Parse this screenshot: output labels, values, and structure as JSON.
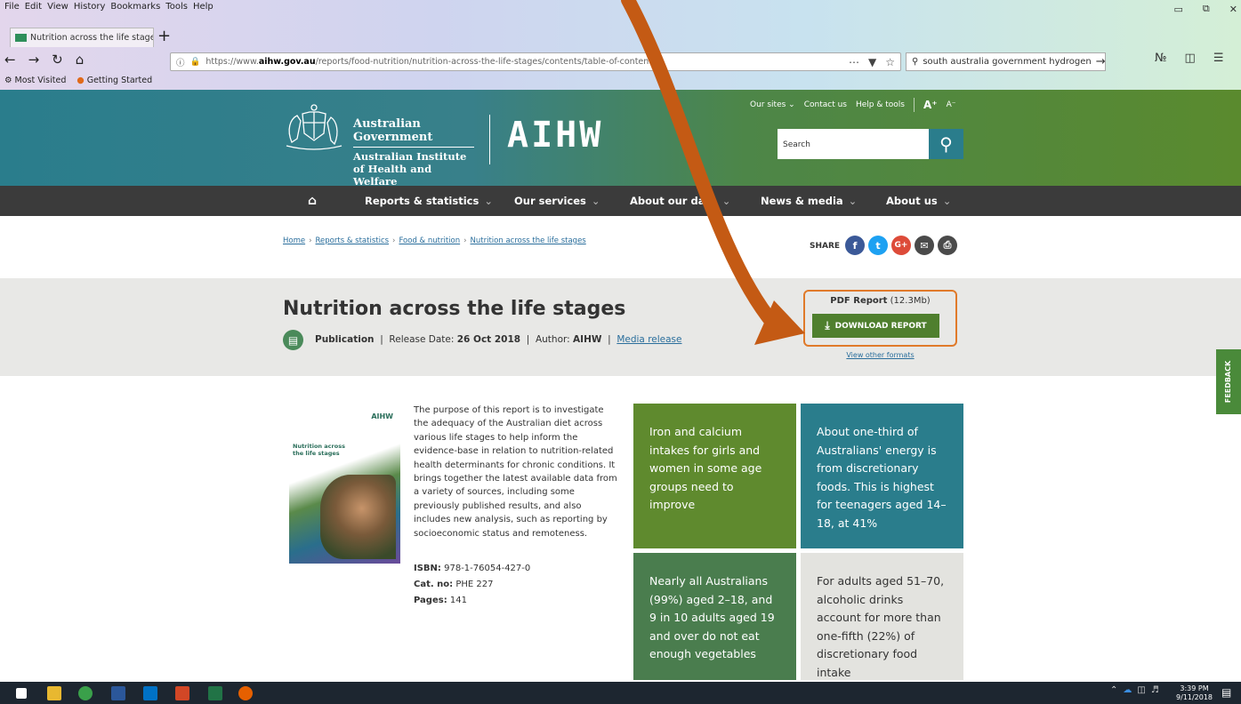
{
  "browser": {
    "menu": [
      "File",
      "Edit",
      "View",
      "History",
      "Bookmarks",
      "Tools",
      "Help"
    ],
    "tab_title": "Nutrition across the life stages",
    "url_prefix": "https://www.",
    "url_host": "aihw.gov.au",
    "url_path": "/reports/food-nutrition/nutrition-across-the-life-stages/contents/table-of-contents",
    "search_query": "south australia government hydrogen",
    "bookmarks": [
      "Most Visited",
      "Getting Started"
    ]
  },
  "site": {
    "gov_line1": "Australian Government",
    "gov_line2": "Australian Institute of Health and Welfare",
    "logo": "AIHW",
    "top_links": [
      "Our sites",
      "Contact us",
      "Help & tools"
    ],
    "font_larger": "A⁺",
    "font_smaller": "A⁻",
    "search_placeholder": "Search",
    "nav": [
      "Reports & statistics",
      "Our services",
      "About our data",
      "News & media",
      "About us"
    ],
    "breadcrumb": [
      "Home",
      "Reports & statistics",
      "Food & nutrition",
      "Nutrition across the life stages"
    ],
    "share_label": "SHARE"
  },
  "report": {
    "title": "Nutrition across the life stages",
    "type": "Publication",
    "release_label": "Release Date:",
    "release_date": "26 Oct 2018",
    "author_label": "Author:",
    "author": "AIHW",
    "media_release": "Media release",
    "pdf_label": "PDF Report",
    "pdf_size": "(12.3Mb)",
    "download_label": "DOWNLOAD REPORT",
    "other_formats": "View other formats",
    "feedback": "FEEDBACK",
    "cover_title": "Nutrition across the life stages",
    "cover_logo": "AIHW",
    "description": "The purpose of this report is to investigate the adequacy of the Australian diet across various life stages to help inform the evidence-base in relation to nutrition-related health determinants for chronic conditions. It brings together the latest available data from a variety of sources, including some previously published results, and also includes new analysis, such as reporting by socioeconomic status and remoteness.",
    "isbn_label": "ISBN:",
    "isbn": "978-1-76054-427-0",
    "catno_label": "Cat. no:",
    "catno": "PHE 227",
    "pages_label": "Pages:",
    "pages": "141"
  },
  "tiles": [
    "Iron and calcium intakes for girls and women in some age groups need to improve",
    "About one-third of Australians' energy is from discretionary foods. This is highest for teenagers aged 14–18, at 41%",
    "Nearly all Australians (99%) aged 2–18, and 9 in 10 adults aged 19 and over do not eat enough vegetables",
    "For adults aged 51–70, alcoholic drinks account for more than one-fifth (22%) of discretionary food intake"
  ],
  "taskbar": {
    "time": "3:39 PM",
    "date": "9/11/2018"
  },
  "colors": {
    "header_teal": "#2a7d8c",
    "header_green": "#5a8a2e",
    "download_green": "#4f7f2e",
    "highlight_orange": "#e07a2a",
    "annotation_arrow": "#c45a14"
  }
}
